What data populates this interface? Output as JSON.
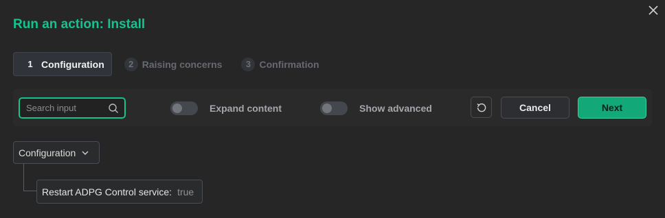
{
  "dialog": {
    "title": "Run an action: Install",
    "close_icon": "close-icon"
  },
  "steps": [
    {
      "num": "1",
      "label": "Configuration",
      "active": true
    },
    {
      "num": "2",
      "label": "Raising concerns",
      "active": false
    },
    {
      "num": "3",
      "label": "Confirmation",
      "active": false
    }
  ],
  "toolbar": {
    "search_placeholder": "Search input",
    "expand_label": "Expand content",
    "expand_on": false,
    "advanced_label": "Show advanced",
    "advanced_on": false,
    "reset_icon": "reset-icon",
    "cancel_label": "Cancel",
    "next_label": "Next"
  },
  "tree": {
    "root_label": "Configuration",
    "items": [
      {
        "label": "Restart ADPG Control service:",
        "value": "true"
      }
    ]
  },
  "colors": {
    "accent": "#14c38e",
    "background": "#262626"
  }
}
